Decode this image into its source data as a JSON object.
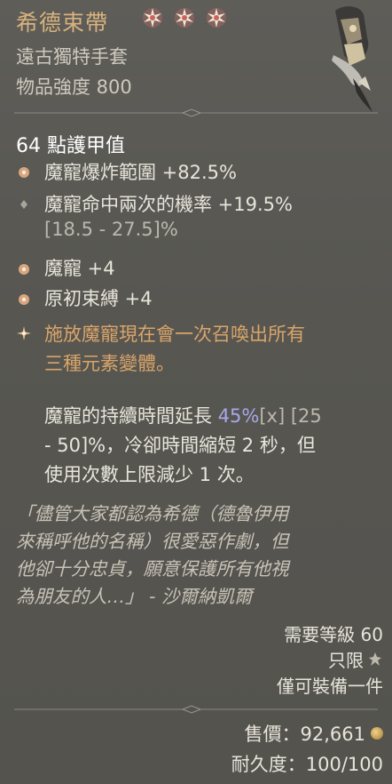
{
  "item": {
    "name": "希德束帶",
    "type": "遠古獨特手套",
    "power": "物品強度 800",
    "armor": "64 點護甲值"
  },
  "affixes": [
    {
      "text": "魔寵爆炸範圍 +82.5%",
      "bullet": "star-bullet-icon"
    },
    {
      "text": "魔寵命中兩次的機率 +19.5%",
      "range": "[18.5 - 27.5]%",
      "bullet": "diamond-bullet-icon"
    },
    {
      "text": "魔寵 +4",
      "bullet": "star-bullet-icon"
    },
    {
      "text": "原初束縛 +4",
      "bullet": "star-bullet-icon"
    }
  ],
  "aspect": {
    "line1": "施放魔寵現在會一次召喚出所有",
    "line2": "三種元素變體。",
    "body_a": "魔寵的",
    "body_b": "持續時間延長",
    "body_c": " 45%",
    "body_d": "[x] [25",
    "body_e": "- 50]%，冷卻時間縮短 2 秒，但",
    "body_f": "使用次數上限減少 1 次。"
  },
  "flavor": {
    "line1": "「儘管大家都認為希德（德魯伊用",
    "line2": "來稱呼他的名稱）很愛惡作劇，但",
    "line3": "他卻十分忠貞，願意保護所有他視",
    "line4": "為朋友的人…」 - 沙爾納凱爾"
  },
  "requirements": {
    "level": "需要等級 60",
    "unique": "只限",
    "equip_limit": "僅可裝備一件"
  },
  "footer": {
    "price": "售價：92,661",
    "durability": "耐久度：100/100"
  },
  "colors": {
    "name": "#d9b27e",
    "aspect": "#d9a56a",
    "highlight_blue": "#a7a8ea"
  }
}
